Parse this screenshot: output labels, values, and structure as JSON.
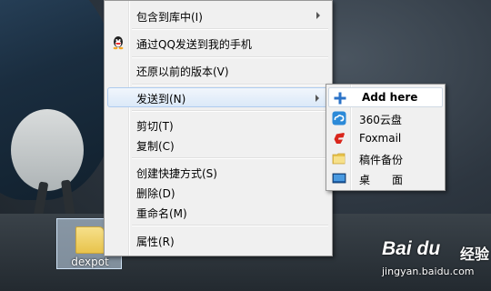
{
  "desktop": {
    "icon": {
      "label": "dexpot",
      "icon_name": "folder-icon"
    }
  },
  "context_menu": {
    "items": [
      {
        "label": "包含到库中(I)",
        "has_submenu": true
      },
      {
        "label": "通过QQ发送到我的手机",
        "icon": "qq-penguin-icon"
      },
      {
        "label": "还原以前的版本(V)"
      },
      {
        "label": "发送到(N)",
        "has_submenu": true,
        "highlighted": true
      },
      {
        "label": "剪切(T)"
      },
      {
        "label": "复制(C)"
      },
      {
        "label": "创建快捷方式(S)"
      },
      {
        "label": "删除(D)"
      },
      {
        "label": "重命名(M)"
      },
      {
        "label": "属性(R)"
      }
    ]
  },
  "send_to_submenu": {
    "items": [
      {
        "label": "Add here",
        "icon": "plus-icon",
        "highlighted": true
      },
      {
        "label": "360云盘",
        "icon": "cloud-disk-icon"
      },
      {
        "label": "Foxmail",
        "icon": "foxmail-icon"
      },
      {
        "label": "稿件备份",
        "icon": "folder-icon"
      },
      {
        "label": "桌　　面",
        "icon": "desktop-icon"
      }
    ]
  },
  "watermark": {
    "logo": "Bai du",
    "logo_suffix": "经验",
    "url": "jingyan.baidu.com"
  },
  "colors": {
    "menu_bg": "#f0f0f0",
    "highlight_border": "#aecbee",
    "foxmail_red": "#d9261c",
    "plus_blue": "#2b73c8"
  }
}
